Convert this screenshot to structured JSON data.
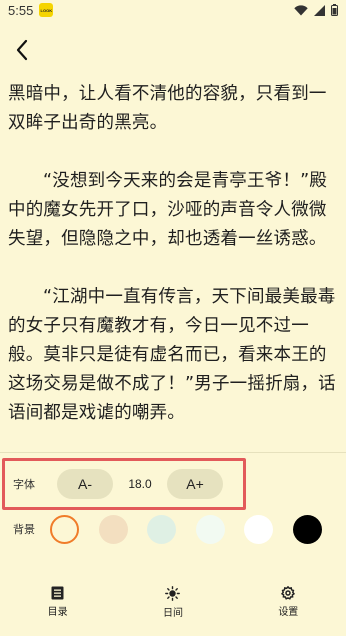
{
  "status_bar": {
    "time": "5:55",
    "app_badge": "LOOK"
  },
  "content": {
    "paragraphs": [
      "黑暗中，让人看不清他的容貌，只看到一双眸子出奇的黑亮。",
      "“没想到今天来的会是青亭王爷！”殿中的魔女先开了口，沙哑的声音令人微微失望，但隐隐之中，却也透着一丝诱惑。",
      "“江湖中一直有传言，天下间最美最毒的女子只有魔教才有，今日一见不过一般。莫非只是徒有虚名而已，看来本王的这场交易是做不成了！”男子一摇折扇，话语间都是戏谑的嘲弄。"
    ]
  },
  "settings": {
    "font_label": "字体",
    "font_decrease": "A-",
    "font_size": "18.0",
    "font_increase": "A+",
    "bg_label": "背景",
    "bg_colors": [
      "#fcf7d5",
      "#f3dfc0",
      "#dff0e4",
      "#f2faf2",
      "#ffffff",
      "#000000"
    ],
    "bg_selected_index": 0,
    "highlight_color": "#e25a5a",
    "selected_ring_color": "#f07c2a"
  },
  "bottom_nav": {
    "items": [
      {
        "label": "目录",
        "icon": "catalog-icon"
      },
      {
        "label": "日间",
        "icon": "sun-icon"
      },
      {
        "label": "设置",
        "icon": "gear-icon"
      }
    ]
  }
}
